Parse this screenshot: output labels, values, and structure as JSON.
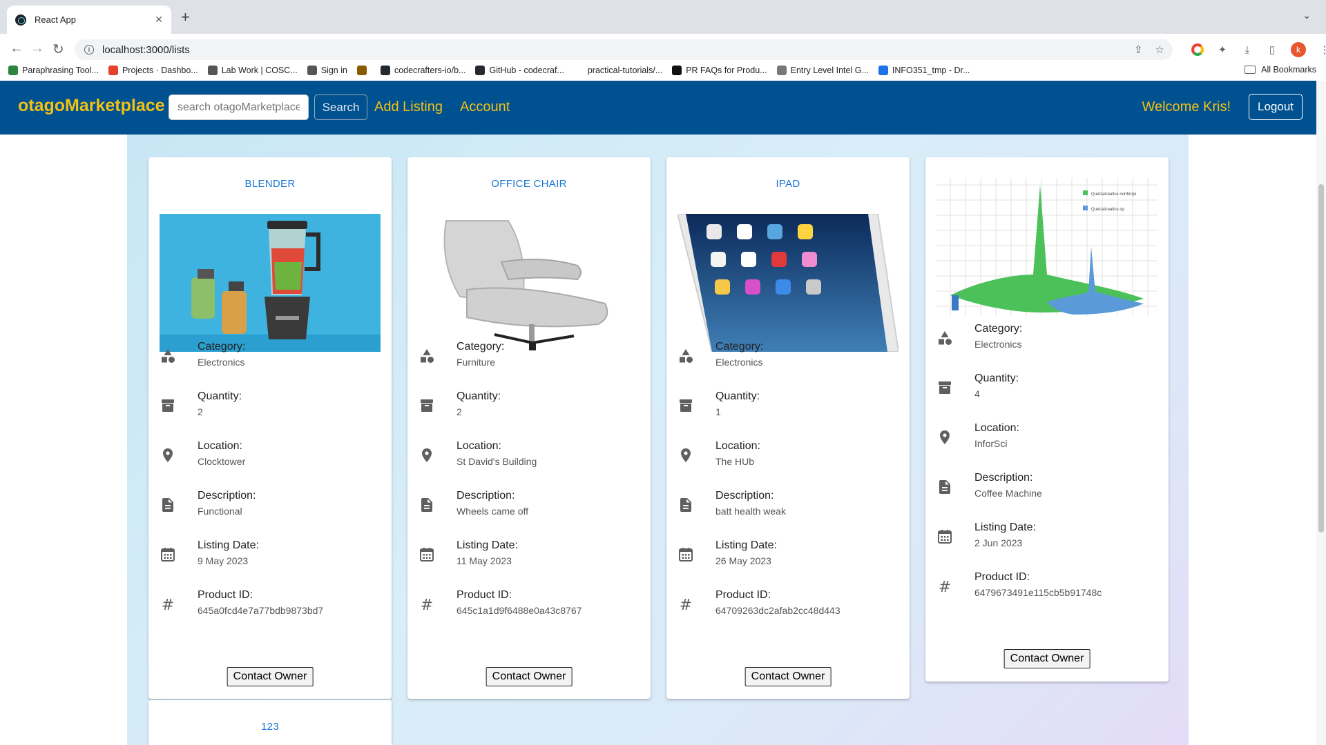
{
  "browser": {
    "tab_title": "React App",
    "new_tab": "+",
    "url": "localhost:3000/lists",
    "bookmarks": [
      {
        "label": "Paraphrasing Tool...",
        "color": "#2e8540"
      },
      {
        "label": "Projects · Dashbo...",
        "color": "#e24329"
      },
      {
        "label": "Lab Work | COSC...",
        "color": "#555555"
      },
      {
        "label": "Sign in",
        "color": "#555555"
      },
      {
        "label": "",
        "color": "#8a5a00"
      },
      {
        "label": "codecrafters-io/b...",
        "color": "#24292f"
      },
      {
        "label": "GitHub - codecraf...",
        "color": "#24292f"
      },
      {
        "label": "practical-tutorials/...",
        "color": "#ffffff"
      },
      {
        "label": "PR FAQs for Produ...",
        "color": "#111111"
      },
      {
        "label": "Entry Level Intel G...",
        "color": "#777777"
      },
      {
        "label": "INFO351_tmp - Dr...",
        "color": "#1a73e8"
      }
    ],
    "all_bookmarks": "All Bookmarks",
    "avatar_letter": "k"
  },
  "header": {
    "brand": "otagoMarketplace",
    "search_placeholder": "search otagoMarketplace",
    "search_button": "Search",
    "add_listing": "Add Listing",
    "account": "Account",
    "welcome": "Welcome Kris!",
    "logout": "Logout",
    "colors": {
      "bar": "#005190",
      "accent": "#f3c014"
    }
  },
  "labels": {
    "category": "Category:",
    "quantity": "Quantity:",
    "location": "Location:",
    "description": "Description:",
    "listing_date": "Listing Date:",
    "product_id": "Product ID:",
    "contact": "Contact Owner"
  },
  "listings": [
    {
      "title": "BLENDER",
      "image": "blender-photo",
      "category": "Electronics",
      "quantity": "2",
      "location": "Clocktower",
      "description": "Functional",
      "listing_date": "9 May 2023",
      "product_id": "645a0fcd4e7a77bdb9873bd7"
    },
    {
      "title": "OFFICE CHAIR",
      "image": "office-chair-photo",
      "category": "Furniture",
      "quantity": "2",
      "location": "St David's Building",
      "description": "Wheels came off",
      "listing_date": "11 May 2023",
      "product_id": "645c1a1d9f6488e0a43c8767"
    },
    {
      "title": "IPAD",
      "image": "ipad-photo",
      "category": "Electronics",
      "quantity": "1",
      "location": "The HUb",
      "description": "batt health weak",
      "listing_date": "26 May 2023",
      "product_id": "64709263dc2afab2cc48d443"
    },
    {
      "title": "",
      "image": "chart-image",
      "image_legend": [
        "Quetzalcoatlus northropi",
        "Quetzalcoatlus sp."
      ],
      "category": "Electronics",
      "quantity": "4",
      "location": "InforSci",
      "description": "Coffee Machine",
      "listing_date": "2 Jun 2023",
      "product_id": "6479673491e115cb5b91748c"
    },
    {
      "title": "123"
    }
  ]
}
